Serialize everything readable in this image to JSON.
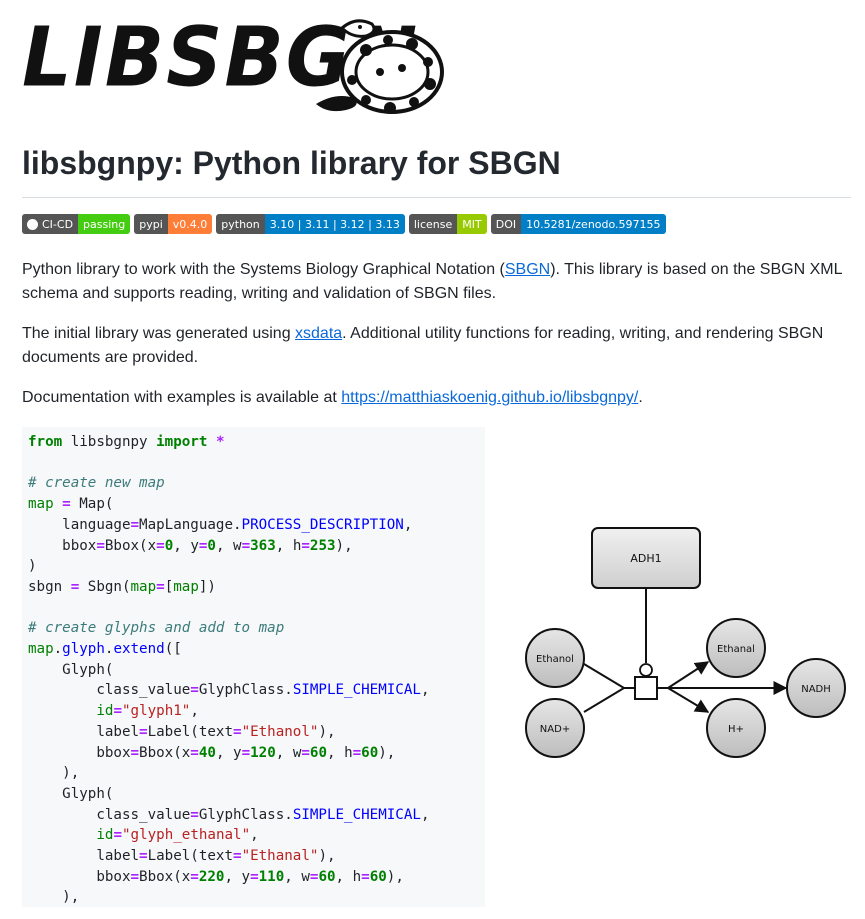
{
  "logo": {
    "text": "LIBSBGN",
    "image": "snake-logo"
  },
  "title": "libsbgnpy: Python library for SBGN",
  "badges": [
    {
      "label": "CI-CD",
      "value": "passing",
      "color": "#44cc11",
      "icon": "github-icon"
    },
    {
      "label": "pypi",
      "value": "v0.4.0",
      "color": "#fe7d37"
    },
    {
      "label": "python",
      "value": "3.10 | 3.11 | 3.12 | 3.13",
      "color": "#007ec6"
    },
    {
      "label": "license",
      "value": "MIT",
      "color": "#97ca00"
    },
    {
      "label": "DOI",
      "value": "10.5281/zenodo.597155",
      "color": "#007ec6"
    }
  ],
  "para1": {
    "pre": "Python library to work with the Systems Biology Graphical Notation (",
    "link": "SBGN",
    "post": "). This library is based on the SBGN XML schema and supports reading, writing and validation of SBGN files."
  },
  "para2": {
    "pre": "The initial library was generated using ",
    "link": "xsdata",
    "post": ". Additional utility functions for reading, writing, and rendering SBGN documents are provided."
  },
  "para3": {
    "pre": "Documentation with examples is available at ",
    "link": "https://matthiaskoenig.github.io/libsbgnpy/",
    "post": "."
  },
  "code": {
    "lines": [
      "from libsbgnpy import *",
      "",
      "# create new map",
      "map = Map(",
      "    language=MapLanguage.PROCESS_DESCRIPTION,",
      "    bbox=Bbox(x=0, y=0, w=363, h=253),",
      ")",
      "sbgn = Sbgn(map=[map])",
      "",
      "# create glyphs and add to map",
      "map.glyph.extend([",
      "    Glyph(",
      "        class_value=GlyphClass.SIMPLE_CHEMICAL,",
      "        id=\"glyph1\",",
      "        label=Label(text=\"Ethanol\"),",
      "        bbox=Bbox(x=40, y=120, w=60, h=60),",
      "    ),",
      "    Glyph(",
      "        class_value=GlyphClass.SIMPLE_CHEMICAL,",
      "        id=\"glyph_ethanal\",",
      "        label=Label(text=\"Ethanal\"),",
      "        bbox=Bbox(x=220, y=110, w=60, h=60),",
      "    ),"
    ]
  },
  "diagram": {
    "macromolecule": "ADH1",
    "chemicals": [
      "Ethanol",
      "NAD+",
      "Ethanal",
      "H+",
      "NADH"
    ]
  }
}
